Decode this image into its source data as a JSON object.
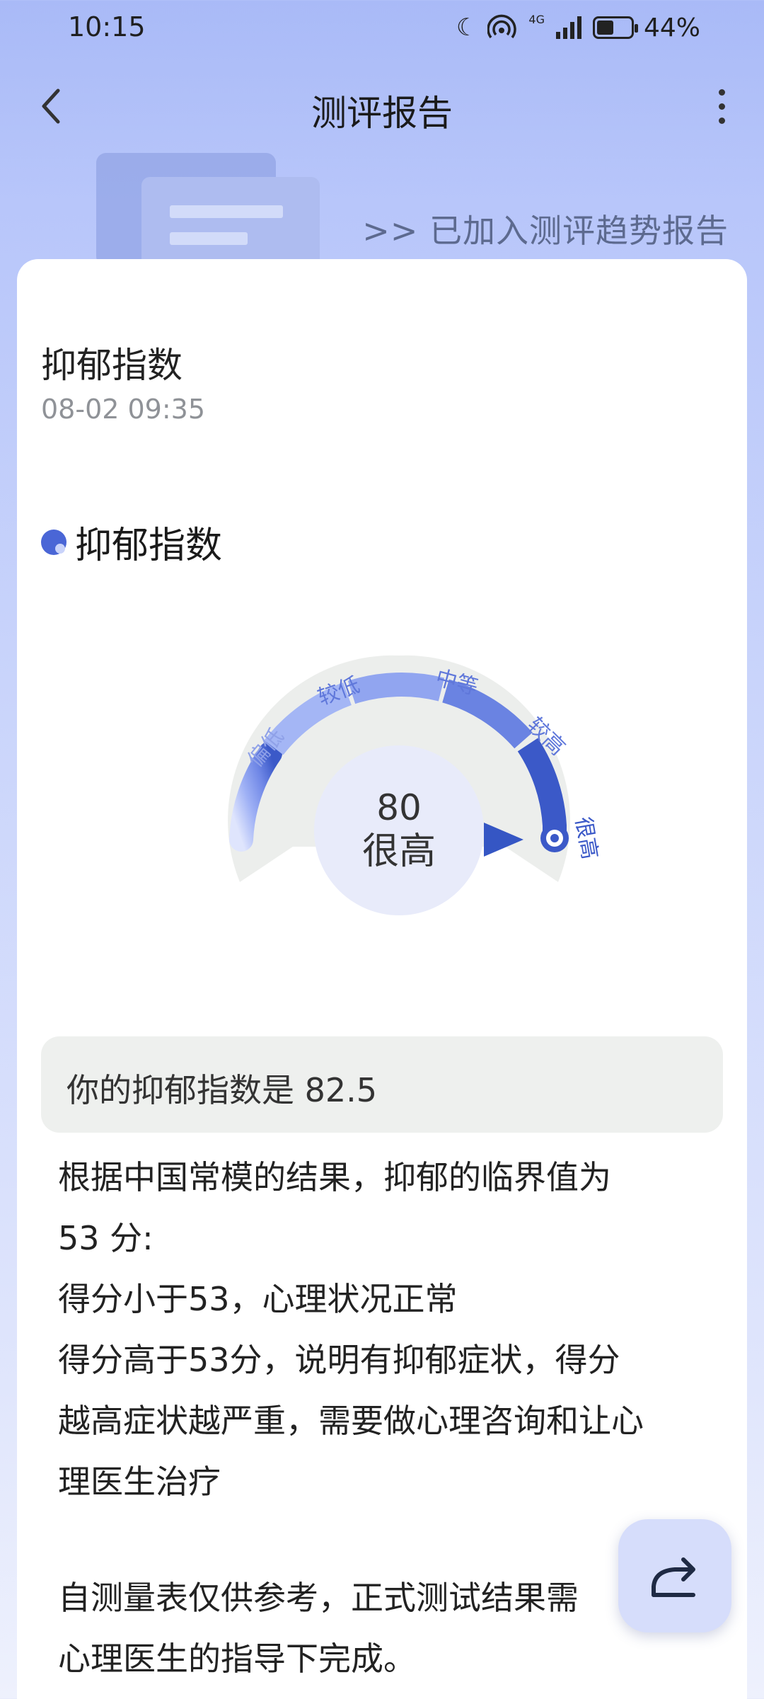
{
  "status_bar": {
    "time": "10:15",
    "battery_text": "44%",
    "battery_level": 0.44,
    "icons": [
      "moon-icon",
      "wifi-icon",
      "signal-icon",
      "battery-icon"
    ],
    "network_label": "4G"
  },
  "nav": {
    "title": "测评报告",
    "back_icon": "chevron-left-icon",
    "more_icon": "more-vertical-icon"
  },
  "banner": {
    "link_text": ">> 已加入测评趋势报告"
  },
  "report": {
    "title": "抑郁指数",
    "date": "08-02 09:35"
  },
  "section": {
    "title": "抑郁指数"
  },
  "gauge": {
    "score": "80",
    "level": "很高",
    "labels": [
      "偏低",
      "较低",
      "中等",
      "较高",
      "很高"
    ],
    "accent_color": "#3b59c8",
    "light_color": "#d6ddfb"
  },
  "result": {
    "text": "你的抑郁指数是 82.5"
  },
  "description": {
    "lines": [
      "根据中国常模的结果，抑郁的临界值为",
      "53 分:",
      "得分小于53，心理状况正常",
      "得分高于53分，说明有抑郁症状，得分",
      "越高症状越严重，需要做心理咨询和让心",
      "理医生治疗"
    ]
  },
  "disclaimer": {
    "lines": [
      "自测量表仅供参考，正式测试结果需",
      "心理医生的指导下完成。"
    ]
  },
  "share": {
    "icon": "share-icon"
  }
}
